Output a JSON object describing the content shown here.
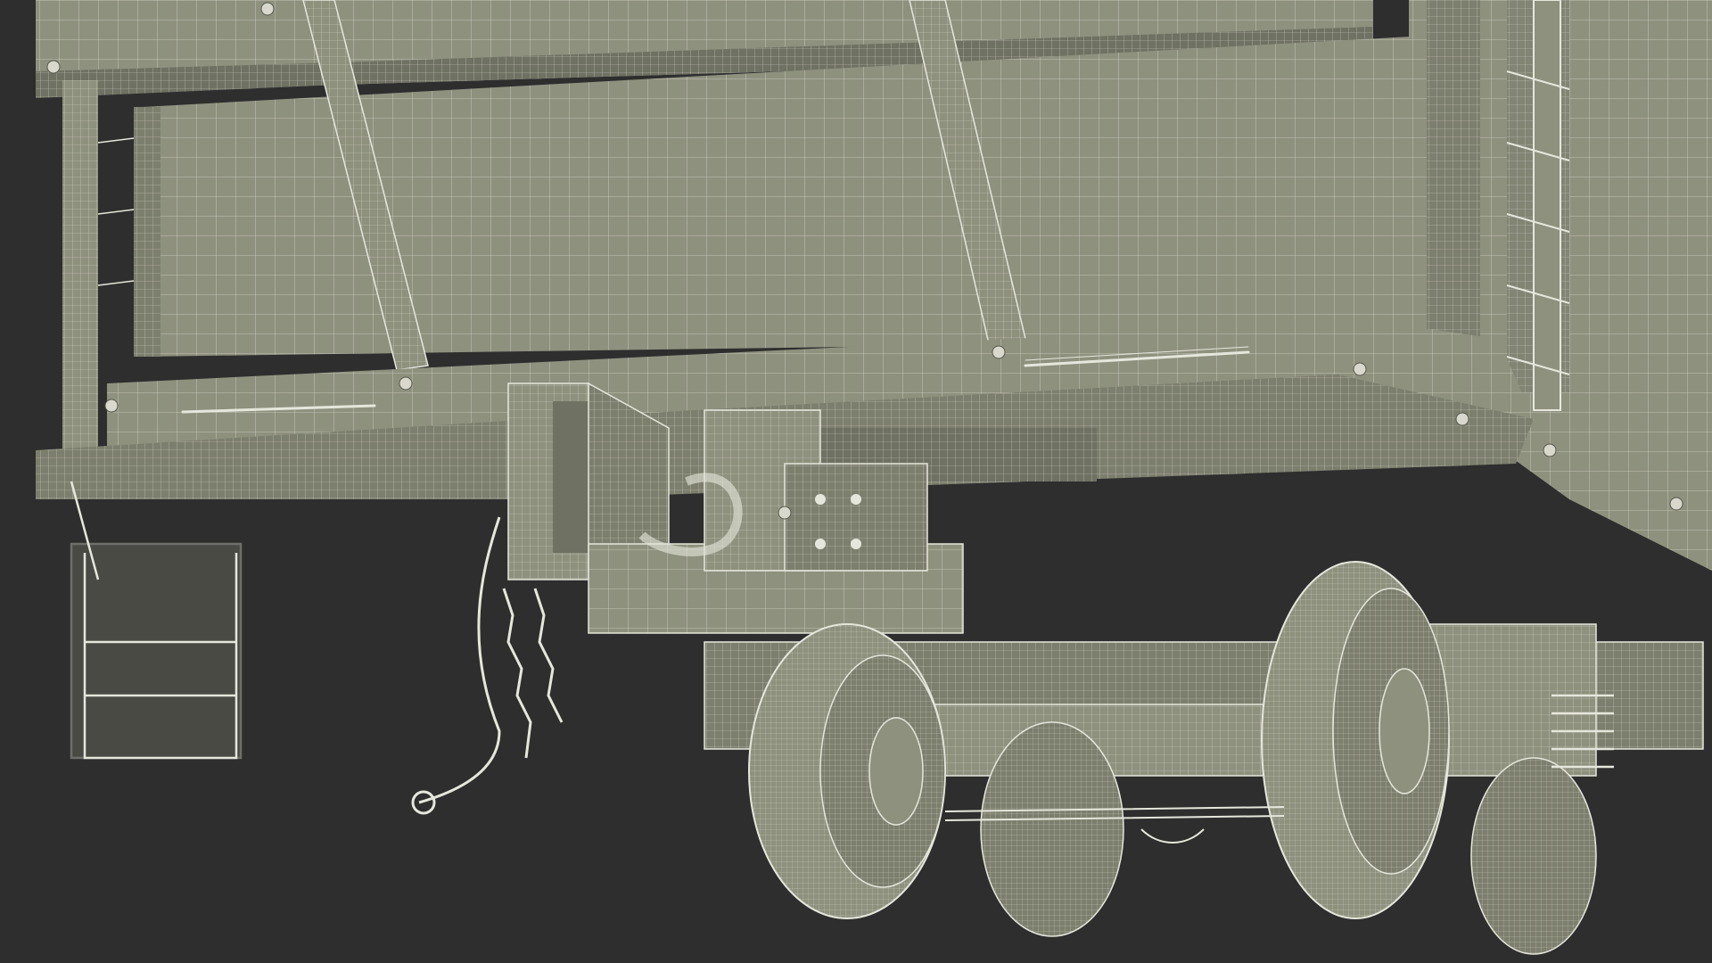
{
  "scene": {
    "background_color": "#2e2e2e",
    "body_fill": "#8f917f",
    "body_fill_dark": "#6f7163",
    "body_fill_light": "#a3a591",
    "wire_color": "#e6e7dc",
    "shadow_color": "#55574c"
  }
}
